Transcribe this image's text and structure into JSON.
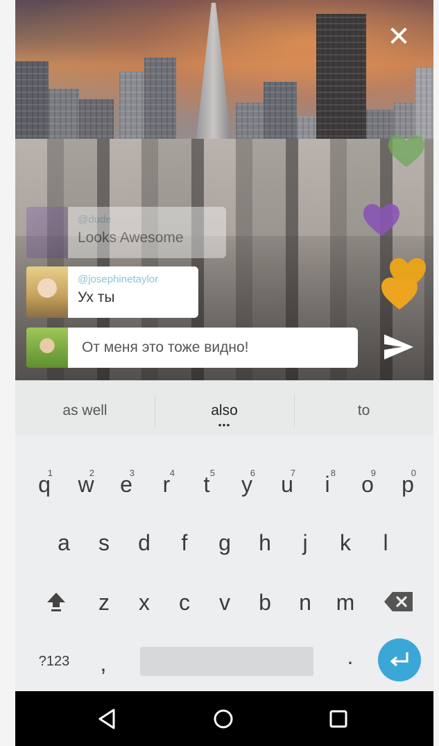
{
  "video": {
    "close_icon": "close-icon"
  },
  "comments": [
    {
      "user": "@dude",
      "text": "Looks Awesome"
    },
    {
      "user": "@josephinetaylor",
      "text": "Ух ты"
    }
  ],
  "chat": {
    "input_value": "От меня это тоже видно!",
    "send_icon": "send-icon"
  },
  "hearts": [
    {
      "color": "#6fa85a"
    },
    {
      "color": "#8a55b5"
    },
    {
      "color": "#e8a31c"
    },
    {
      "color": "#eda420"
    }
  ],
  "keyboard": {
    "suggestions": [
      "as well",
      "also",
      "to"
    ],
    "suggestion_dots": "•••",
    "row1": [
      {
        "key": "q",
        "hint": "1"
      },
      {
        "key": "w",
        "hint": "2"
      },
      {
        "key": "e",
        "hint": "3"
      },
      {
        "key": "r",
        "hint": "4"
      },
      {
        "key": "t",
        "hint": "5"
      },
      {
        "key": "y",
        "hint": "6"
      },
      {
        "key": "u",
        "hint": "7"
      },
      {
        "key": "i",
        "hint": "8"
      },
      {
        "key": "o",
        "hint": "9"
      },
      {
        "key": "p",
        "hint": "0"
      }
    ],
    "row2": [
      "a",
      "s",
      "d",
      "f",
      "g",
      "h",
      "j",
      "k",
      "l"
    ],
    "row3": [
      "z",
      "x",
      "c",
      "v",
      "b",
      "n",
      "m"
    ],
    "symbols_key": "?123",
    "comma_key": ",",
    "period_key": ".",
    "accent_color": "#3aa7d6"
  },
  "navbar": {
    "icons": [
      "back-icon",
      "home-icon",
      "recents-icon"
    ]
  }
}
